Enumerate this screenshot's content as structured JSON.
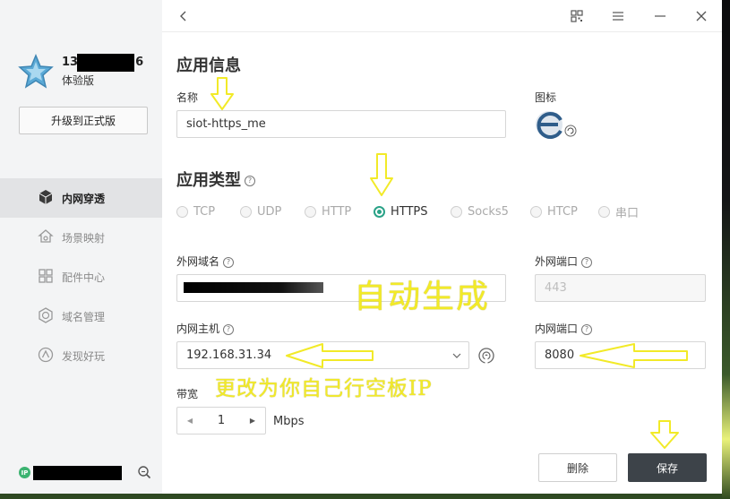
{
  "sidebar": {
    "user_name_prefix": "13",
    "user_name_suffix": "6",
    "plan": "体验版",
    "upgrade_label": "升级到正式版",
    "items": [
      {
        "label": "内网穿透",
        "icon": "cube-icon",
        "active": true
      },
      {
        "label": "场景映射",
        "icon": "home-icon",
        "active": false
      },
      {
        "label": "配件中心",
        "icon": "grid-icon",
        "active": false
      },
      {
        "label": "域名管理",
        "icon": "globe-icon",
        "active": false
      },
      {
        "label": "发现好玩",
        "icon": "compass-icon",
        "active": false
      }
    ],
    "status_badge": "IP"
  },
  "topbar": {
    "back_icon": "chevron-left-icon",
    "qr_icon": "qr-code-icon",
    "menu_icon": "menu-icon",
    "minimize_icon": "minimize-icon",
    "close_icon": "close-icon"
  },
  "app_info": {
    "title": "应用信息",
    "name_label": "名称",
    "name_value": "siot-https_me",
    "icon_label": "图标"
  },
  "app_type": {
    "title": "应用类型",
    "options": [
      {
        "label": "TCP",
        "checked": false
      },
      {
        "label": "UDP",
        "checked": false
      },
      {
        "label": "HTTP",
        "checked": false
      },
      {
        "label": "HTTPS",
        "checked": true
      },
      {
        "label": "Socks5",
        "checked": false
      },
      {
        "label": "HTCP",
        "checked": false
      },
      {
        "label": "串口",
        "checked": false
      }
    ]
  },
  "network": {
    "external_domain_label": "外网域名",
    "external_port_label": "外网端口",
    "external_port_value": "443",
    "internal_host_label": "内网主机",
    "internal_host_value": "192.168.31.34",
    "internal_port_label": "内网端口",
    "internal_port_value": "8080",
    "bandwidth_label": "带宽",
    "bandwidth_value": "1",
    "bandwidth_unit": "Mbps"
  },
  "actions": {
    "delete_label": "删除",
    "save_label": "保存"
  },
  "annotations": {
    "auto_generate": "自动生成",
    "change_to_own": "更改为你自己行空板IP",
    "color": "#f2ea28"
  }
}
